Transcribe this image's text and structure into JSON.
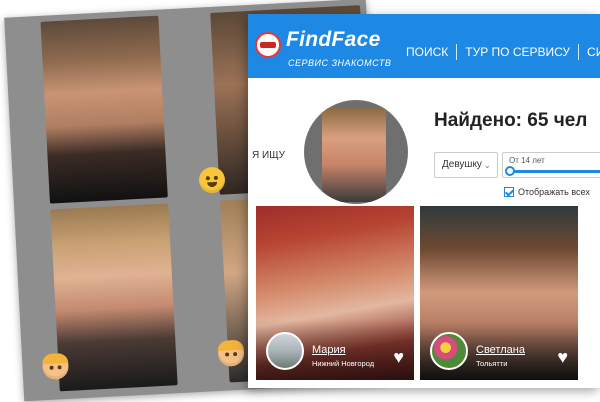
{
  "window": {
    "brand": "FindFace",
    "brand_subtitle": "СЕРВИС ЗНАКОМСТВ",
    "nav": [
      "ПОИСК",
      "ТУР ПО СЕРВИСУ",
      "СИ"
    ]
  },
  "search": {
    "seek_label": "Я ИЩУ",
    "found_text": "Найдено: 65 чел",
    "gender_value": "Девушку",
    "age_label": "От 14 лет",
    "show_all_label": "Отображать всех"
  },
  "results": [
    {
      "name": "Мария",
      "city": "Нижний Новгород"
    },
    {
      "name": "Светлана",
      "city": "Тольятти"
    }
  ],
  "colors": {
    "accent": "#1e88e5",
    "logo_red": "#e53935"
  },
  "icons": [
    "heart-icon",
    "chevron-down-icon",
    "checkbox-icon",
    "emoji-icon"
  ]
}
